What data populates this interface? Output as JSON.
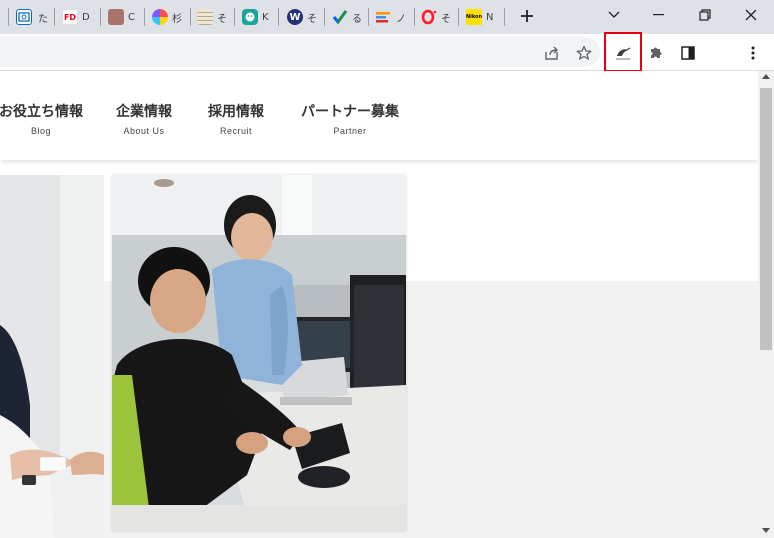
{
  "browser": {
    "tabs": [
      {
        "icon": "outlook-icon",
        "title": "",
        "color": "#0f6cbd"
      },
      {
        "icon": "teams-icon",
        "title": "た",
        "color": "#6264a7"
      },
      {
        "icon": "fd-icon",
        "title": "D",
        "color": "#e60012"
      },
      {
        "icon": "brown-square-icon",
        "title": "C",
        "color": "#a8736b"
      },
      {
        "icon": "colorful-ball-icon",
        "title": "杉",
        "color": "#ff6b6b"
      },
      {
        "icon": "grid-icon",
        "title": "そ",
        "color": "#c8b89a"
      },
      {
        "icon": "face-icon",
        "title": "K",
        "color": "#1ba39c"
      },
      {
        "icon": "wordpress-icon",
        "title": "そ",
        "color": "#21307a"
      },
      {
        "icon": "check-icon",
        "title": "る",
        "color": "#1e8e3e"
      },
      {
        "icon": "bars-icon",
        "title": "ノ",
        "color": "#f29900"
      },
      {
        "icon": "opera-icon",
        "title": "そ",
        "color": "#ff1b2d"
      },
      {
        "icon": "nikon-icon",
        "title": "N",
        "color": "#ffe100"
      }
    ],
    "new_tab_label": "+",
    "accent_highlight": "#e60012"
  },
  "nav": {
    "items": [
      {
        "ja": "お役立ち情報",
        "en": "Blog"
      },
      {
        "ja": "企業情報",
        "en": "About Us"
      },
      {
        "ja": "採用情報",
        "en": "Recruit"
      },
      {
        "ja": "パートナー募集",
        "en": "Partner"
      }
    ]
  }
}
